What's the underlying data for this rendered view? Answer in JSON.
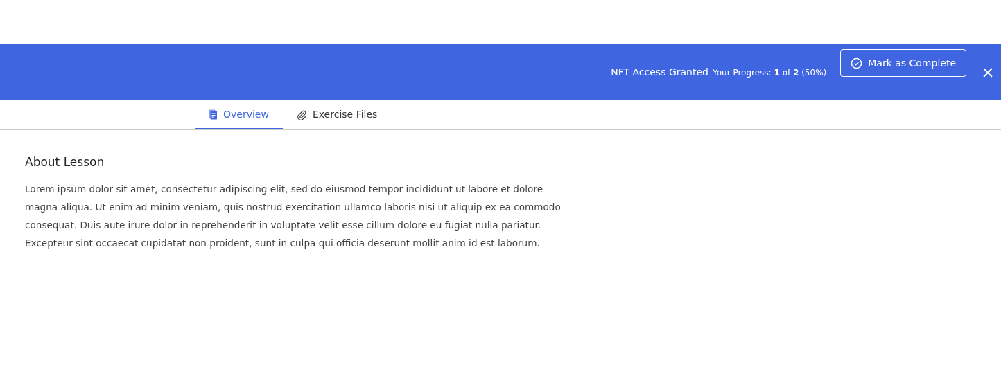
{
  "header": {
    "access_label": "NFT Access Granted",
    "progress": "Your Progress: **1** of **2** (50%)",
    "complete_button": "Mark as Complete"
  },
  "tabs": [
    {
      "label": "Overview",
      "kind": "document",
      "selected": true
    },
    {
      "label": "Exercise Files",
      "kind": "attachment",
      "selected": false
    }
  ],
  "lesson": {
    "title": "About Lesson",
    "body": "Lorem ipsum dolor sit amet, consectetur adipiscing elit, sed do eiusmod tempor incididunt ut labore et dolore magna aliqua. Ut enim ad minim veniam, quis nostrud exercitation ullamco laboris nisi ut aliquip ex ea commodo consequat. Duis aute irure dolor in reprehenderit in voluptate velit esse cillum dolore eu fugiat nulla pariatur. Excepteur sint occaecat cupidatat non proident, sunt in culpa qui officia deserunt mollit anim id est laborum."
  }
}
